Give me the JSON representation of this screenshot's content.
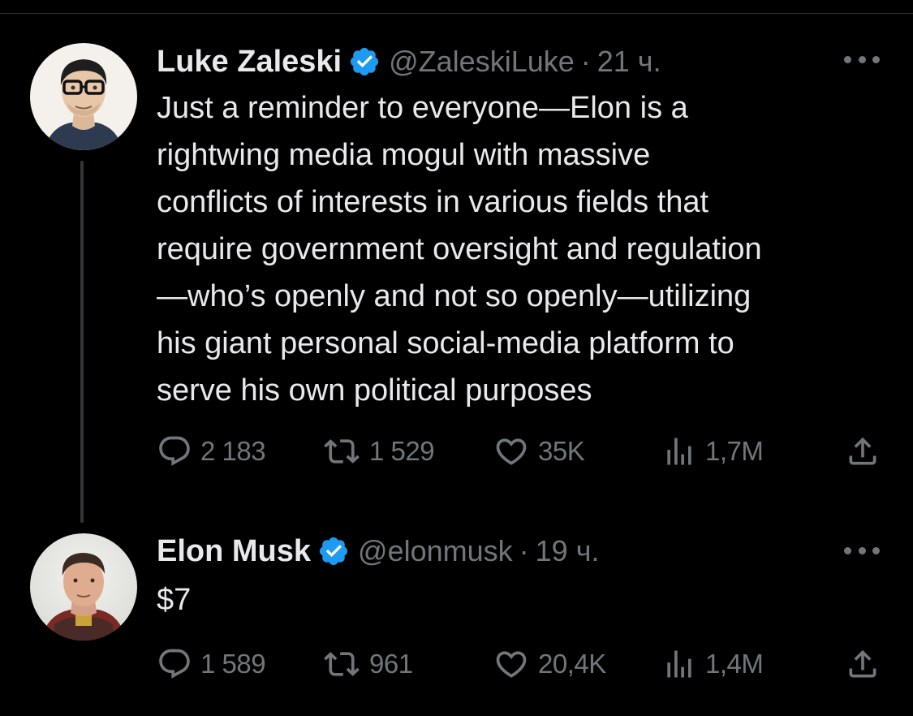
{
  "colors": {
    "background": "#000000",
    "text_primary": "#e7e9ea",
    "text_secondary": "#71767b",
    "verified_badge": "#1d9bf0",
    "thread_line": "#333639"
  },
  "tweets": [
    {
      "author": "Luke Zaleski",
      "verified_icon": "verified-badge-icon",
      "handle": "@ZaleskiLuke",
      "separator": "·",
      "time": "21 ч.",
      "text_lines": [
        "Just a reminder to everyone—Elon is a",
        "rightwing media mogul with massive",
        "conflicts of interests in various fields that",
        "require government oversight and regulation",
        "—who’s openly and not so openly—utilizing",
        "his giant personal social-media platform to",
        "serve his own political purposes"
      ],
      "actions": {
        "replies": "2 183",
        "reposts": "1 529",
        "likes": "35K",
        "views": "1,7M"
      }
    },
    {
      "author": "Elon Musk",
      "verified_icon": "verified-badge-icon",
      "handle": "@elonmusk",
      "separator": "·",
      "time": "19 ч.",
      "text_lines": [
        "$7"
      ],
      "actions": {
        "replies": "1 589",
        "reposts": "961",
        "likes": "20,4K",
        "views": "1,4M"
      }
    }
  ],
  "icons": {
    "reply": "reply-icon",
    "repost": "repost-icon",
    "like": "heart-icon",
    "views": "views-icon",
    "share": "share-icon",
    "more": "more-dots-icon"
  }
}
